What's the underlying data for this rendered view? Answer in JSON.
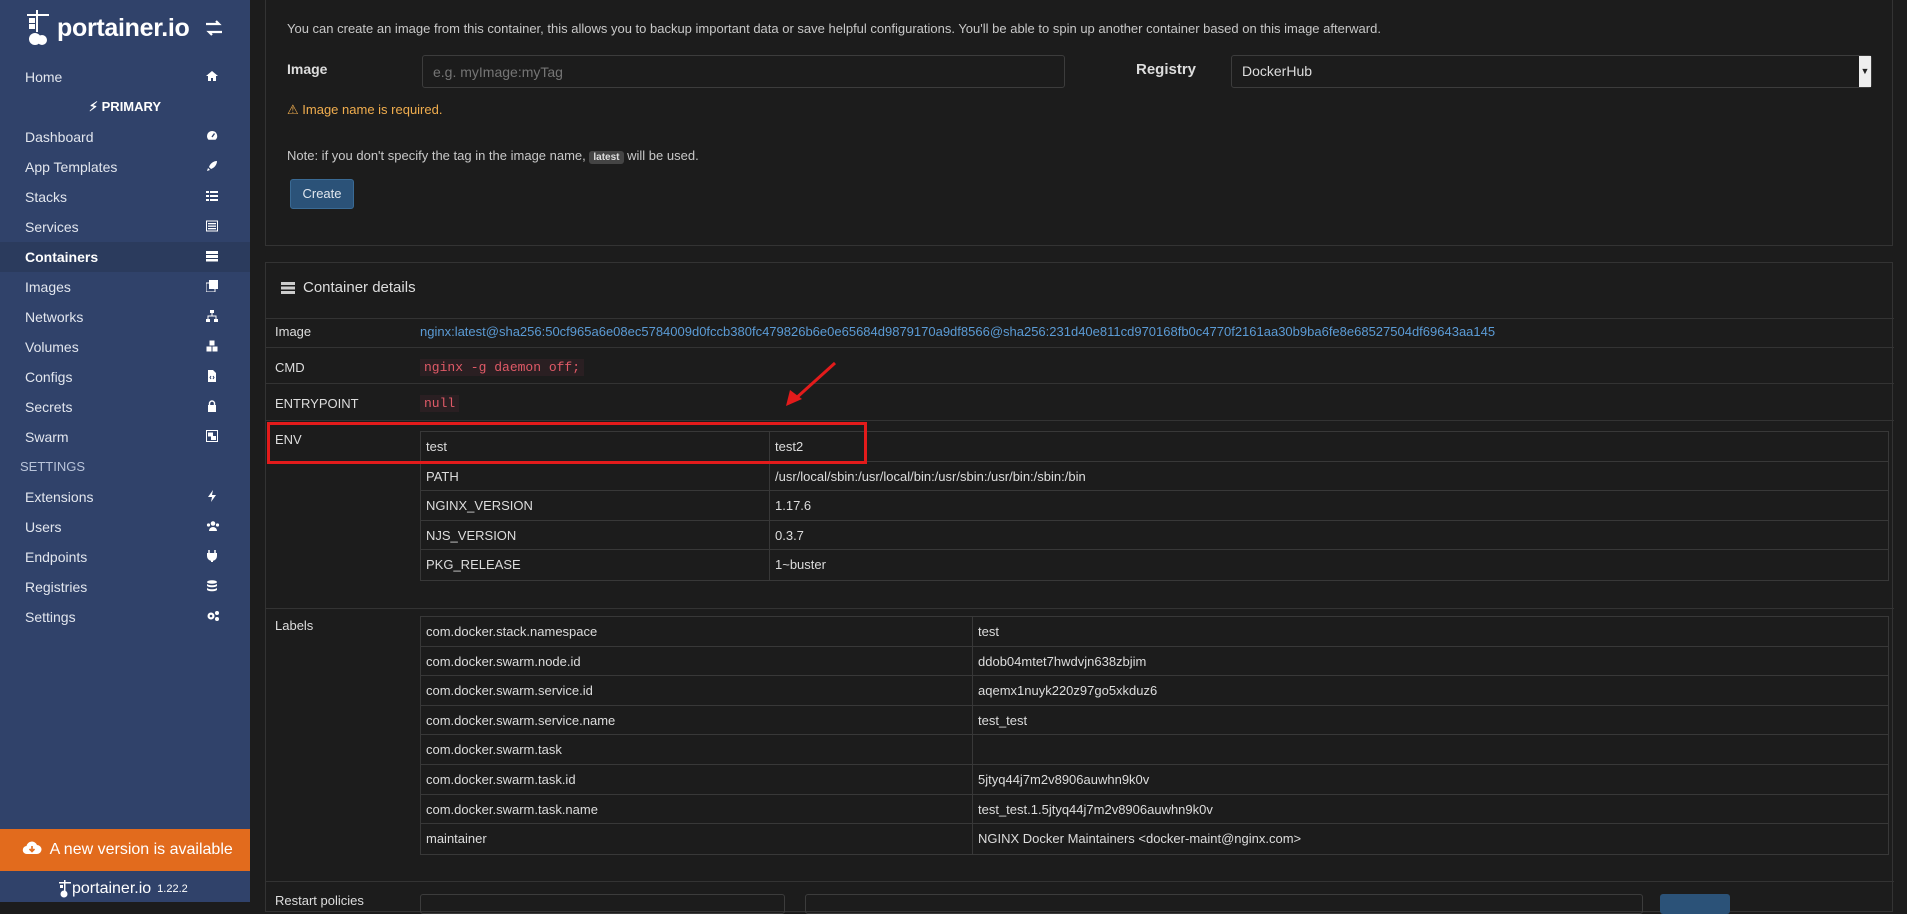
{
  "sidebar": {
    "brand": "portainer.io",
    "endpoint": "PRIMARY",
    "items": [
      {
        "label": "Home",
        "icon": "home-icon"
      },
      {
        "label": "Dashboard",
        "icon": "tachometer-icon"
      },
      {
        "label": "App Templates",
        "icon": "rocket-icon"
      },
      {
        "label": "Stacks",
        "icon": "list-icon"
      },
      {
        "label": "Services",
        "icon": "list-alt-icon"
      },
      {
        "label": "Containers",
        "icon": "server-icon"
      },
      {
        "label": "Images",
        "icon": "clone-icon"
      },
      {
        "label": "Networks",
        "icon": "sitemap-icon"
      },
      {
        "label": "Volumes",
        "icon": "cubes-icon"
      },
      {
        "label": "Configs",
        "icon": "file-code-icon"
      },
      {
        "label": "Secrets",
        "icon": "lock-icon"
      },
      {
        "label": "Swarm",
        "icon": "object-group-icon"
      }
    ],
    "settings_header": "SETTINGS",
    "settings_items": [
      {
        "label": "Extensions",
        "icon": "bolt-icon"
      },
      {
        "label": "Users",
        "icon": "users-icon"
      },
      {
        "label": "Endpoints",
        "icon": "plug-icon"
      },
      {
        "label": "Registries",
        "icon": "database-icon"
      },
      {
        "label": "Settings",
        "icon": "cogs-icon"
      }
    ],
    "update_banner": "A new version is available",
    "footer_brand": "portainer.io",
    "version": "1.22.2"
  },
  "create_image": {
    "intro": "You can create an image from this container, this allows you to backup important data or save helpful configurations. You'll be able to spin up another container based on this image afterward.",
    "image_label": "Image",
    "image_placeholder": "e.g. myImage:myTag",
    "registry_label": "Registry",
    "registry_value": "DockerHub",
    "warning": "Image name is required.",
    "note_before": "Note: if you don't specify the tag in the image name,",
    "note_tag": "latest",
    "note_after": "will be used.",
    "create_button": "Create"
  },
  "details": {
    "title": "Container details",
    "image_label": "Image",
    "image_value": "nginx:latest@sha256:50cf965a6e08ec5784009d0fccb380fc479826b6e0e65684d9879170a9df8566@sha256:231d40e811cd970168fb0c4770f2161aa30b9ba6fe8e68527504df69643aa145",
    "cmd_label": "CMD",
    "cmd_value": "nginx -g daemon off;",
    "entrypoint_label": "ENTRYPOINT",
    "entrypoint_value": "null",
    "env_label": "ENV",
    "env": [
      {
        "key": "test",
        "value": "test2"
      },
      {
        "key": "PATH",
        "value": "/usr/local/sbin:/usr/local/bin:/usr/sbin:/usr/bin:/sbin:/bin"
      },
      {
        "key": "NGINX_VERSION",
        "value": "1.17.6"
      },
      {
        "key": "NJS_VERSION",
        "value": "0.3.7"
      },
      {
        "key": "PKG_RELEASE",
        "value": "1~buster"
      }
    ],
    "labels_label": "Labels",
    "labels": [
      {
        "key": "com.docker.stack.namespace",
        "value": "test"
      },
      {
        "key": "com.docker.swarm.node.id",
        "value": "ddob04mtet7hwdvjn638zbjim"
      },
      {
        "key": "com.docker.swarm.service.id",
        "value": "aqemx1nuyk220z97go5xkduz6"
      },
      {
        "key": "com.docker.swarm.service.name",
        "value": "test_test"
      },
      {
        "key": "com.docker.swarm.task",
        "value": ""
      },
      {
        "key": "com.docker.swarm.task.id",
        "value": "5jtyq44j7m2v8906auwhn9k0v"
      },
      {
        "key": "com.docker.swarm.task.name",
        "value": "test_test.1.5jtyq44j7m2v8906auwhn9k0v"
      },
      {
        "key": "maintainer",
        "value": "NGINX Docker Maintainers <docker-maint@nginx.com>"
      }
    ],
    "restart_label": "Restart policies"
  },
  "colors": {
    "sidebar_bg": "#30426a",
    "accent_orange": "#e26b1d",
    "highlight_red": "#e31b1b",
    "link_blue": "#5b9bd5"
  }
}
